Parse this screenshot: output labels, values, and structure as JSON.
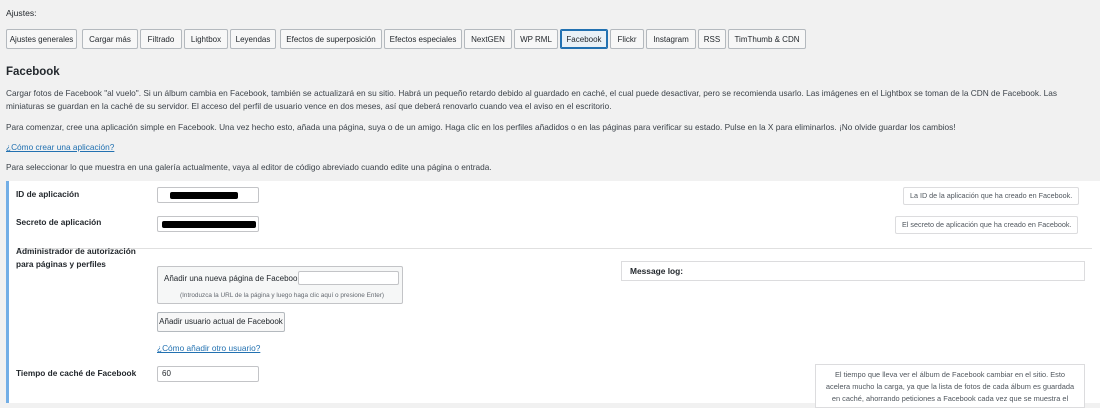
{
  "header": {
    "ajustes_label": "Ajustes:"
  },
  "tabs": [
    {
      "label": "Ajustes generales"
    },
    {
      "label": "Cargar más"
    },
    {
      "label": "Filtrado"
    },
    {
      "label": "Lightbox"
    },
    {
      "label": "Leyendas"
    },
    {
      "label": "Efectos de superposición"
    },
    {
      "label": "Efectos especiales"
    },
    {
      "label": "NextGEN"
    },
    {
      "label": "WP RML"
    },
    {
      "label": "Facebook",
      "active": true
    },
    {
      "label": "Flickr"
    },
    {
      "label": "Instagram"
    },
    {
      "label": "RSS"
    },
    {
      "label": "TimThumb & CDN"
    }
  ],
  "section": {
    "title": "Facebook",
    "paragraph1": "Cargar fotos de Facebook \"al vuelo\". Si un álbum cambia en Facebook, también se actualizará en su sitio. Habrá un pequeño retardo debido al guardado en caché, el cual puede desactivar, pero se recomienda usarlo. Las imágenes en el Lightbox se toman de la CDN de Facebook. Las miniaturas se guardan en la caché de su servidor. El acceso del perfil de usuario vence en dos meses, así que deberá renovarlo cuando vea el aviso en el escritorio.",
    "paragraph2": "Para comenzar, cree una aplicación simple en Facebook. Una vez hecho esto, añada una página, suya o de un amigo. Haga clic en los perfiles añadidos o en las páginas para verificar su estado. Pulse en la X para eliminarlos. ¡No olvide guardar los cambios!",
    "create_app_link": "¿Cómo crear una aplicación?",
    "paragraph3": "Para seleccionar lo que muestra en una galería actualmente, vaya al editor de código abreviado cuando edite una página o entrada."
  },
  "form": {
    "app_id_label": "ID de aplicación",
    "app_id_hint": "La ID de la aplicación que ha creado en Facebook.",
    "app_secret_label": "Secreto de aplicación",
    "app_secret_hint": "El secreto de aplicación que ha creado en Facebook.",
    "auth_admin_label": "Administrador de autorización para páginas y perfiles",
    "add_page_label": "Añadir una nueva página de Facebook",
    "add_page_note": "(Introduzca la URL de la página y luego haga clic aquí o presione Enter)",
    "add_user_button": "Añadir usuario actual de Facebook",
    "add_other_user_link": "¿Cómo añadir otro usuario?",
    "message_log_label": "Message log:",
    "cache_time_label": "Tiempo de caché de Facebook",
    "cache_time_value": "60",
    "cache_time_hint": "El tiempo que lleva ver el álbum de Facebook cambiar en el sitio. Esto acelera mucho la carga, ya que la lista de fotos de cada álbum es guardada en caché, ahorrando peticiones a Facebook cada vez que se muestra el"
  }
}
